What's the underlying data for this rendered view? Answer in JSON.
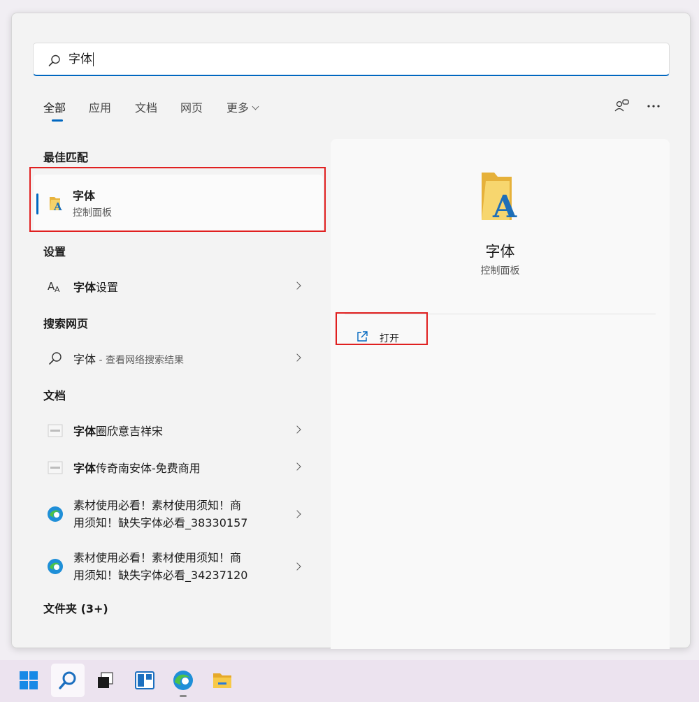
{
  "search": {
    "query": "字体"
  },
  "tabs": [
    {
      "label": "全部",
      "active": true
    },
    {
      "label": "应用"
    },
    {
      "label": "文档"
    },
    {
      "label": "网页"
    },
    {
      "label": "更多"
    }
  ],
  "sections": {
    "best_match": "最佳匹配",
    "settings": "设置",
    "web": "搜索网页",
    "docs": "文档",
    "folders": "文件夹 (3+)"
  },
  "best_match": {
    "title": "字体",
    "subtitle": "控制面板"
  },
  "settings_item": {
    "bold": "字体",
    "rest": "设置",
    "icon": "font-size-icon"
  },
  "web_item": {
    "bold": "字体",
    "rest": " - 查看网络搜索结果",
    "icon": "search-icon"
  },
  "doc_items": [
    {
      "bold": "字体",
      "rest": "圈欣意吉祥宋",
      "icon": "doc-thumbnail-icon"
    },
    {
      "bold": "字体",
      "rest": "传奇南安体-免费商用",
      "icon": "doc-thumbnail-icon"
    },
    {
      "line1": "素材使用必看！素材使用须知！商",
      "line2": "用须知！缺失字体必看_38330157",
      "icon": "edge-icon"
    },
    {
      "line1": "素材使用必看！素材使用须知！商",
      "line2": "用须知！缺失字体必看_34237120",
      "icon": "edge-icon"
    }
  ],
  "preview": {
    "title": "字体",
    "subtitle": "控制面板",
    "open_label": "打开"
  },
  "colors": {
    "accent": "#0067c0",
    "highlight": "#e02020",
    "folder": "#f5c842"
  }
}
